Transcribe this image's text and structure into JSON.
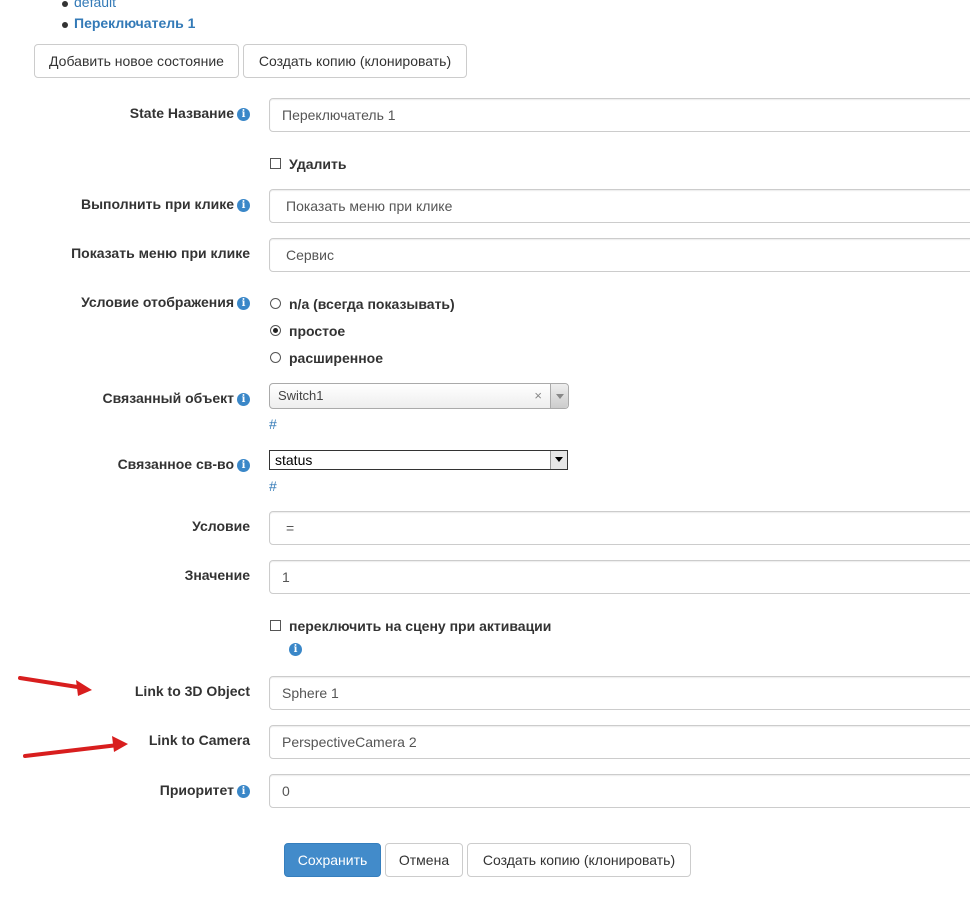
{
  "states_list": [
    {
      "label": "default",
      "active": false
    },
    {
      "label": "Переключатель 1",
      "active": true
    }
  ],
  "top_buttons": {
    "add_state": "Добавить новое состояние",
    "clone": "Создать копию (клонировать)"
  },
  "form": {
    "state_name": {
      "label": "State Название",
      "value": "Переключатель 1"
    },
    "delete": {
      "label": "Удалить"
    },
    "on_click": {
      "label": "Выполнить при клике",
      "value": "Показать меню при клике"
    },
    "menu_on_click": {
      "label": "Показать меню при клике",
      "value": "Сервис"
    },
    "display_condition": {
      "label": "Условие отображения",
      "options": [
        "n/a (всегда показывать)",
        "простое",
        "расширенное"
      ],
      "selected": "простое"
    },
    "linked_object": {
      "label": "Связанный объект",
      "value": "Switch1",
      "clear": "×",
      "link": "#"
    },
    "linked_property": {
      "label": "Связанное св-во",
      "value": "status",
      "link": "#"
    },
    "condition": {
      "label": "Условие",
      "value": "="
    },
    "value": {
      "label": "Значение",
      "value": "1"
    },
    "switch_scene": {
      "label": "переключить на сцену при активации"
    },
    "link_3d": {
      "label": "Link to 3D Object",
      "value": "Sphere 1"
    },
    "link_camera": {
      "label": "Link to Camera",
      "value": "PerspectiveCamera 2"
    },
    "priority": {
      "label": "Приоритет",
      "value": "0"
    }
  },
  "bottom_buttons": {
    "save": "Сохранить",
    "cancel": "Отмена",
    "clone": "Создать копию (клонировать)"
  },
  "info_glyph": "i",
  "colors": {
    "primary": "#428bca",
    "link": "#337ab7",
    "info_icon": "#3a87c8",
    "annotation_arrow": "#d81e1e"
  },
  "icons": [
    "info-icon",
    "red-arrow-annotation"
  ]
}
